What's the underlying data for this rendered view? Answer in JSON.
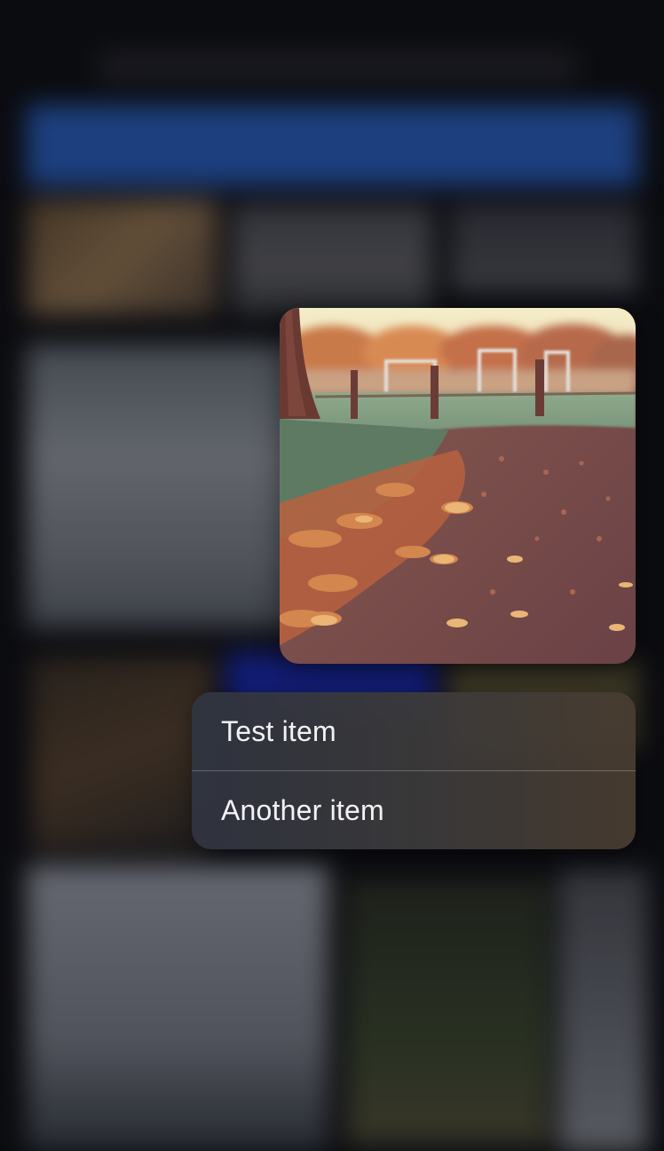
{
  "context_menu": {
    "items": [
      {
        "label": "Test item"
      },
      {
        "label": "Another item"
      }
    ]
  },
  "preview": {
    "subject": "autumn-park-path-photo"
  },
  "colors": {
    "header_blue": "#2a62c4",
    "menu_text": "#f2f2f5"
  }
}
